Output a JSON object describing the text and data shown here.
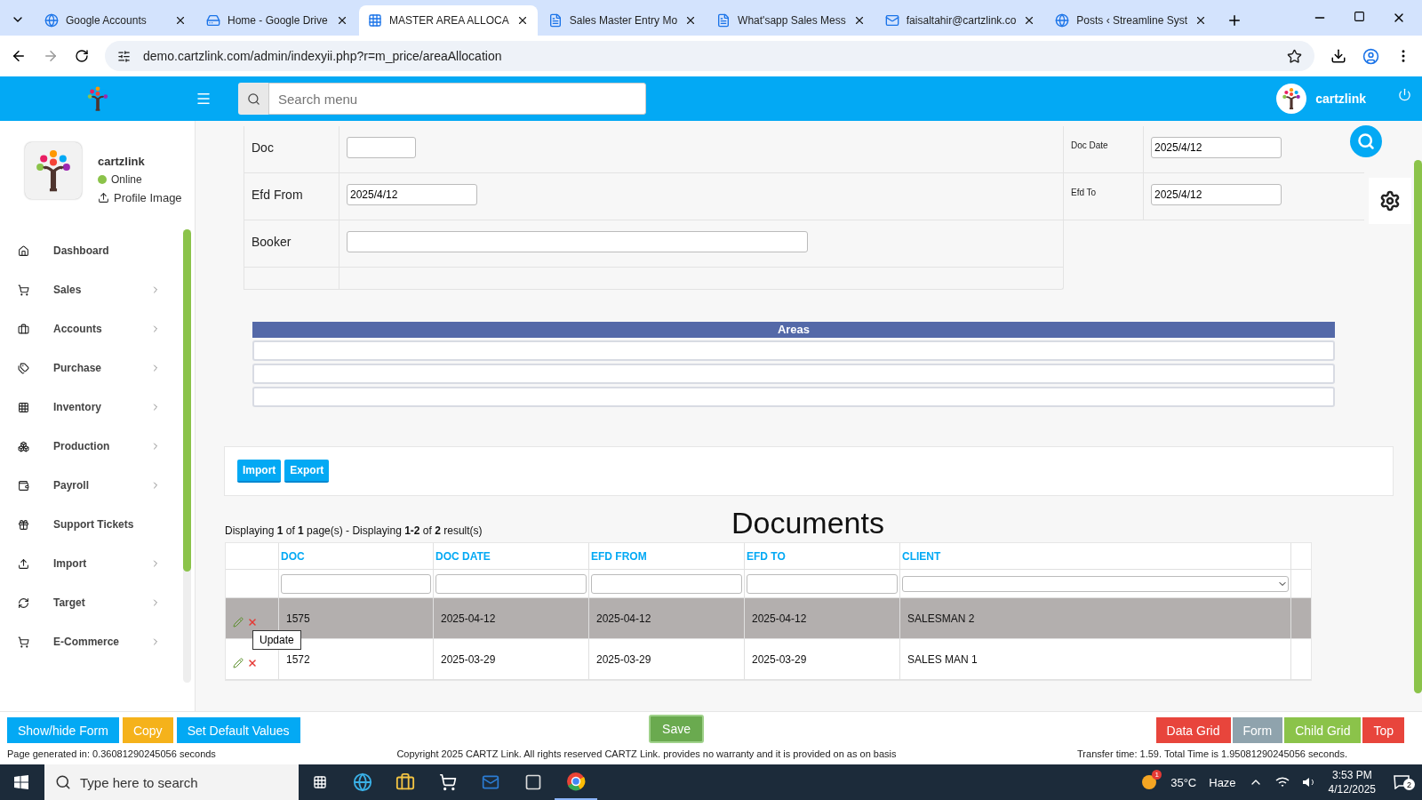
{
  "browser": {
    "tabs": [
      {
        "title": "Google Accounts",
        "selected": false
      },
      {
        "title": "Home - Google Drive",
        "selected": false
      },
      {
        "title": "MASTER AREA ALLOCA",
        "selected": true
      },
      {
        "title": "Sales Master Entry Mo",
        "selected": false
      },
      {
        "title": "What'sapp Sales Mess",
        "selected": false
      },
      {
        "title": "faisaltahir@cartzlink.co",
        "selected": false
      },
      {
        "title": "Posts ‹ Streamline Syst",
        "selected": false
      }
    ],
    "url": "demo.cartzlink.com/admin/indexyii.php?r=m_price/areaAllocation"
  },
  "header": {
    "search_placeholder": "Search menu",
    "user": "cartzlink"
  },
  "profile": {
    "name": "cartzlink",
    "status": "Online",
    "action": "Profile Image"
  },
  "sidebar": {
    "items": [
      {
        "label": "Dashboard",
        "has_submenu": false
      },
      {
        "label": "Sales",
        "has_submenu": true
      },
      {
        "label": "Accounts",
        "has_submenu": true
      },
      {
        "label": "Purchase",
        "has_submenu": true
      },
      {
        "label": "Inventory",
        "has_submenu": true
      },
      {
        "label": "Production",
        "has_submenu": true
      },
      {
        "label": "Payroll",
        "has_submenu": true
      },
      {
        "label": "Support Tickets",
        "has_submenu": false
      },
      {
        "label": "Import",
        "has_submenu": true
      },
      {
        "label": "Target",
        "has_submenu": true
      },
      {
        "label": "E-Commerce",
        "has_submenu": true
      }
    ]
  },
  "form": {
    "left": [
      {
        "label": "Doc",
        "kind": "short"
      },
      {
        "label": "Efd From",
        "value": "2025/4/12",
        "kind": "medium"
      },
      {
        "label": "Booker",
        "kind": "long"
      }
    ],
    "right": [
      {
        "label": "Doc Date",
        "value": "2025/4/12"
      },
      {
        "label": "Efd To",
        "value": "2025/4/12"
      }
    ]
  },
  "areas": {
    "title": "Areas"
  },
  "tools": [
    "Import",
    "Export"
  ],
  "grid": {
    "title": "Documents",
    "pager": "Displaying **1** of **1** page(s)  -  Displaying **1-2** of **2** result(s)",
    "columns": [
      "DOC",
      "DOC DATE",
      "EFD FROM",
      "EFD TO",
      "CLIENT"
    ],
    "rows": [
      {
        "cells": [
          "1575",
          "2025-04-12",
          "2025-04-12",
          "2025-04-12",
          "SALESMAN 2"
        ],
        "selected": true
      },
      {
        "cells": [
          "1572",
          "2025-03-29",
          "2025-03-29",
          "2025-03-29",
          "SALES MAN 1"
        ],
        "selected": false
      }
    ],
    "tooltip": "Update"
  },
  "actions_left": [
    {
      "label": "Show/hide Form",
      "color": "#03a9f4"
    },
    {
      "label": "Copy",
      "color": "#f5b21b"
    },
    {
      "label": "Set Default Values",
      "color": "#03a9f4"
    }
  ],
  "save": "Save",
  "actions_right": [
    {
      "label": "Data Grid",
      "color": "#e8453c"
    },
    {
      "label": "Form",
      "color": "#8fa3ad"
    },
    {
      "label": "Child Grid",
      "color": "#8bc34a"
    },
    {
      "label": "Top",
      "color": "#e8453c"
    }
  ],
  "footer": {
    "generated": "Page generated in: 0.36081290245056 seconds",
    "copyright": "Copyright 2025 CARTZ Link. All rights reserved CARTZ Link. provides no warranty and it is provided on as on basis",
    "transfer": "Transfer time: 1.59. Total Time is 1.95081290245056 seconds."
  },
  "taskbar": {
    "search_placeholder": "Type here to search",
    "weather_badge": "1",
    "temperature": "35°C",
    "condition": "Haze",
    "time": "3:53 PM",
    "date": "4/12/2025",
    "notifications": "2"
  }
}
